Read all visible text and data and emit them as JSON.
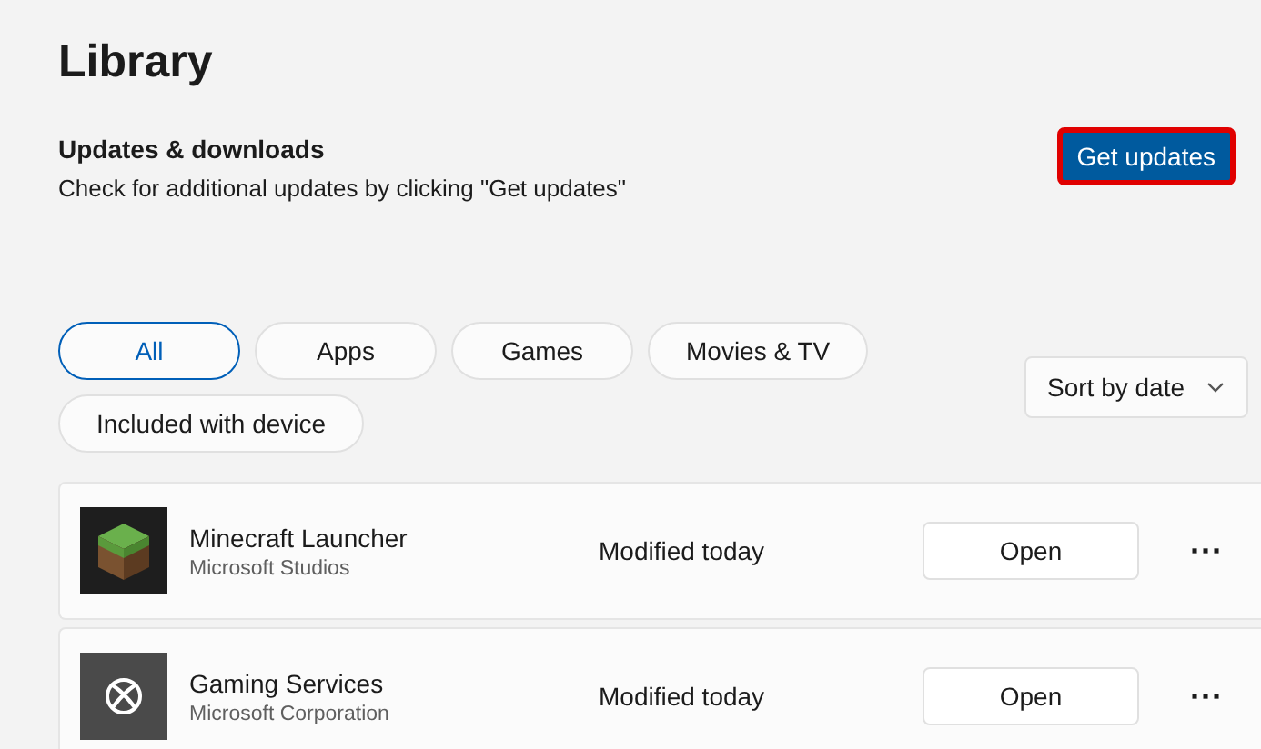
{
  "title": "Library",
  "updates": {
    "heading": "Updates & downloads",
    "description": "Check for additional updates by clicking \"Get updates\"",
    "button": {
      "label": "Get updates",
      "highlighted": true
    }
  },
  "filters": [
    {
      "label": "All",
      "selected": true
    },
    {
      "label": "Apps",
      "selected": false
    },
    {
      "label": "Games",
      "selected": false
    },
    {
      "label": "Movies & TV",
      "selected": false
    },
    {
      "label": "Included with device",
      "selected": false
    }
  ],
  "sort": {
    "label": "Sort by date"
  },
  "apps": [
    {
      "kind": "grass",
      "name": "Minecraft Launcher",
      "publisher": "Microsoft Studios",
      "modified": "Modified today",
      "action": "Open",
      "more": "···"
    },
    {
      "kind": "xbox",
      "name": "Gaming Services",
      "publisher": "Microsoft Corporation",
      "modified": "Modified today",
      "action": "Open",
      "more": "···"
    }
  ]
}
